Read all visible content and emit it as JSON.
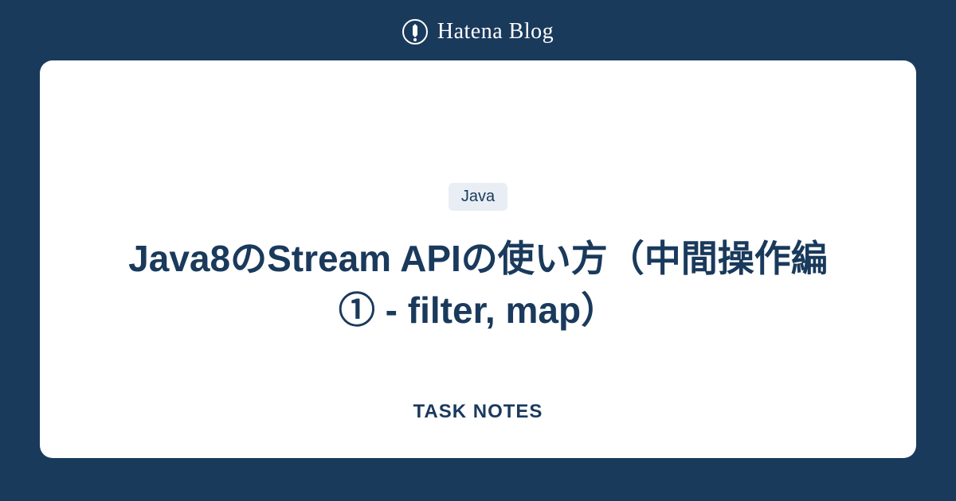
{
  "header": {
    "brand": "Hatena Blog"
  },
  "card": {
    "tag": "Java",
    "title": "Java8のStream APIの使い方（中間操作編① - filter, map）",
    "footer": "TASK NOTES"
  }
}
